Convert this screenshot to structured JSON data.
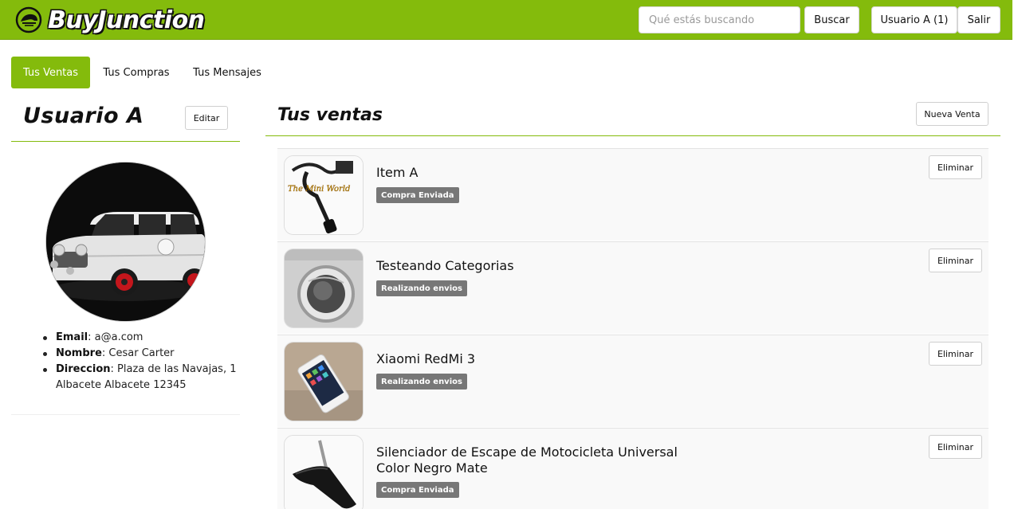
{
  "navbar": {
    "brand": "BuyJunction",
    "brand_icon": "racing-helmet-icon",
    "search_placeholder": "Qué estás buscando",
    "search_button": "Buscar",
    "user_button": "Usuario A (1)",
    "logout_button": "Salir",
    "accent_color": "#84bb0c"
  },
  "tabs": [
    {
      "label": "Tus Ventas",
      "active": true
    },
    {
      "label": "Tus Compras",
      "active": false
    },
    {
      "label": "Tus Mensajes",
      "active": false
    }
  ],
  "profile": {
    "name": "Usuario A",
    "edit_button": "Editar",
    "avatar": "mini-cooper-car-photo",
    "fields": [
      {
        "label": "Email",
        "value": "a@a.com"
      },
      {
        "label": "Nombre",
        "value": "Cesar Carter"
      },
      {
        "label": "Direccion",
        "value": "Plaza de las Navajas, 1 Albacete Albacete 12345"
      }
    ]
  },
  "sales": {
    "title": "Tus ventas",
    "new_button": "Nueva Venta",
    "items": [
      {
        "title": "Item A",
        "status": "Compra Enviada",
        "delete_label": "Eliminar",
        "thumb": "cable-switch-photo",
        "thumb_caption": "The Mini World"
      },
      {
        "title": "Testeando Categorias",
        "status": "Realizando envios",
        "delete_label": "Eliminar",
        "thumb": "washing-machine-photo"
      },
      {
        "title": "Xiaomi RedMi 3",
        "status": "Realizando envios",
        "delete_label": "Eliminar",
        "thumb": "smartphone-photo"
      },
      {
        "title": "Silenciador de Escape de Motocicleta Universal Color Negro Mate",
        "status": "Compra Enviada",
        "delete_label": "Eliminar",
        "thumb": "motorcycle-exhaust-photo"
      }
    ]
  }
}
